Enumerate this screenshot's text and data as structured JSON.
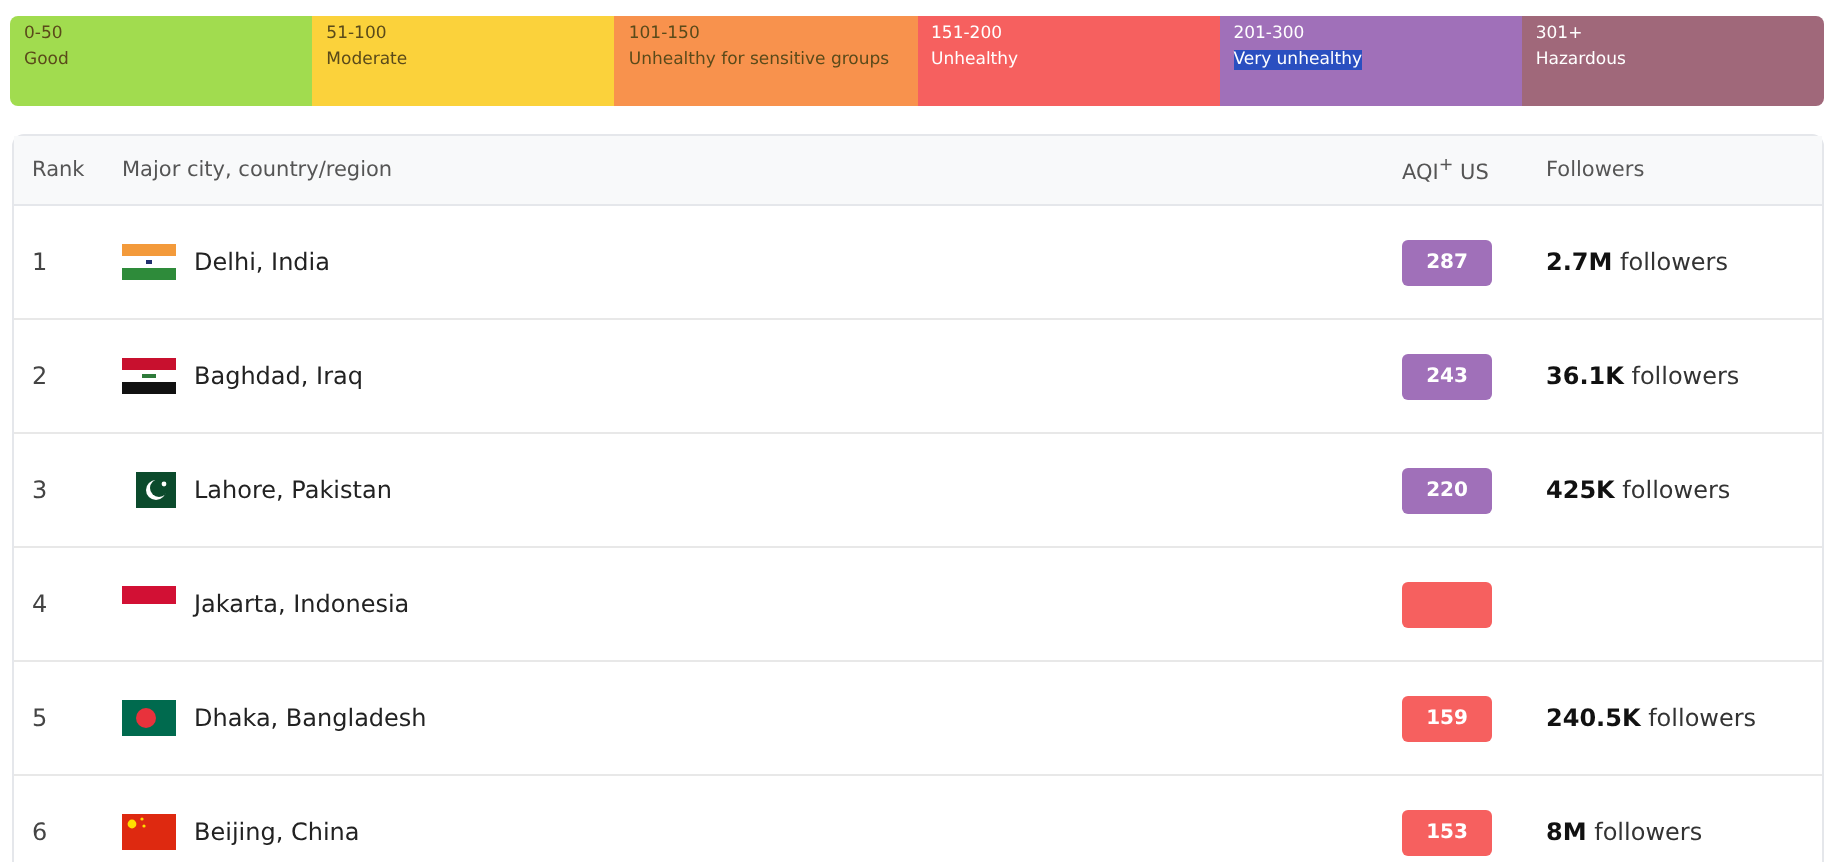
{
  "legend": [
    {
      "range": "0-50",
      "label": "Good",
      "color": "#a1dc4f",
      "selected": false
    },
    {
      "range": "51-100",
      "label": "Moderate",
      "color": "#fbd23b",
      "selected": false
    },
    {
      "range": "101-150",
      "label": "Unhealthy for sensitive groups",
      "color": "#f8924d",
      "selected": false
    },
    {
      "range": "151-200",
      "label": "Unhealthy",
      "color": "#f6605f",
      "selected": false
    },
    {
      "range": "201-300",
      "label": "Very unhealthy",
      "color": "#a070b9",
      "selected": true
    },
    {
      "range": "301+",
      "label": "Hazardous",
      "color": "#a0687a",
      "selected": false
    }
  ],
  "table": {
    "columns": [
      "Rank",
      "Major city, country/region",
      "AQI$^{+}$ US",
      "Followers"
    ],
    "rows": [
      {
        "rank": "1",
        "kind": "india",
        "city": "Delhi, India",
        "aqi": "287",
        "color": "#a070b9",
        "followers": "**2.7M** followers"
      },
      {
        "rank": "2",
        "kind": "iraq",
        "city": "Baghdad, Iraq",
        "aqi": "243",
        "color": "#a070b9",
        "followers": "**36.1K** followers"
      },
      {
        "rank": "3",
        "kind": "pakistan",
        "city": "Lahore, Pakistan",
        "aqi": "220",
        "color": "#a070b9",
        "followers": "**425K** followers"
      },
      {
        "rank": "4",
        "kind": "indonesia",
        "city": "Jakarta, Indonesia",
        "color": "#f6605f"
      },
      {
        "rank": "5",
        "kind": "bangladesh",
        "city": "Dhaka, Bangladesh",
        "aqi": "159",
        "color": "#f6605f",
        "followers": "**240.5K** followers"
      },
      {
        "rank": "6",
        "kind": "china",
        "city": "Beijing, China",
        "aqi": "153",
        "color": "#f6605f",
        "followers": "**8M** followers"
      }
    ]
  }
}
